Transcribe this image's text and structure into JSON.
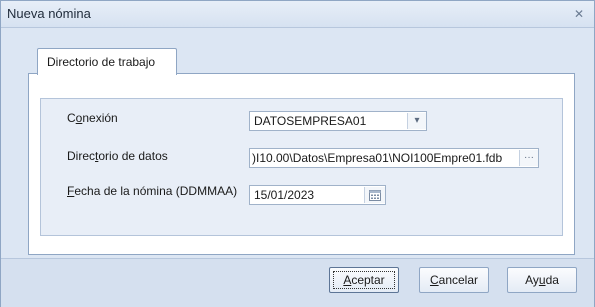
{
  "window": {
    "title": "Nueva nómina",
    "close_glyph": "✕"
  },
  "tab": {
    "label": "Directorio de trabajo"
  },
  "form": {
    "conexion": {
      "label_pre": "C",
      "label_u": "o",
      "label_post": "nexión",
      "value": "DATOSEMPRESA01"
    },
    "directorio": {
      "label_pre": "Direc",
      "label_u": "t",
      "label_post": "orio de datos",
      "value": ")I10.00\\Datos\\Empresa01\\NOI100Empre01.fdb"
    },
    "fecha": {
      "label_pre": "",
      "label_u": "F",
      "label_post": "echa de la nómina (DDMMAA)",
      "value": "15/01/2023"
    }
  },
  "buttons": {
    "aceptar": {
      "pre": "",
      "u": "A",
      "post": "ceptar"
    },
    "cancelar": {
      "pre": "",
      "u": "C",
      "post": "ancelar"
    },
    "ayuda": {
      "pre": "Ay",
      "u": "u",
      "post": "da"
    }
  }
}
